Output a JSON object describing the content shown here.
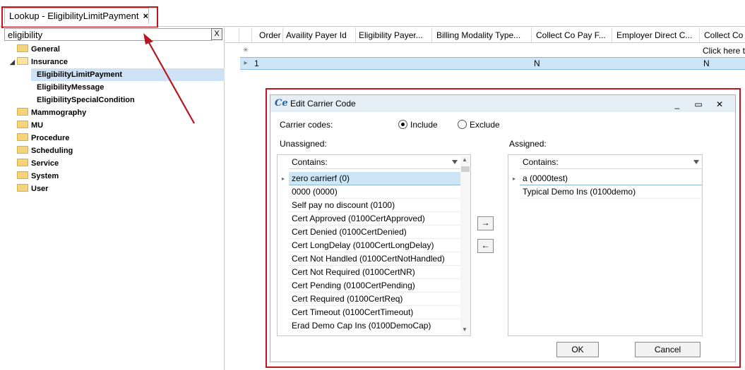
{
  "tab": {
    "title": "Lookup - EligibilityLimitPayment",
    "close": "×"
  },
  "tree": {
    "search_value": "eligibility",
    "clear_label": "X",
    "items": [
      {
        "label": "General"
      },
      {
        "label": "Insurance",
        "expanded": true
      },
      {
        "label": "EligibilityLimitPayment",
        "selected": true
      },
      {
        "label": "EligibilityMessage"
      },
      {
        "label": "EligibilitySpecialCondition"
      },
      {
        "label": "Mammography"
      },
      {
        "label": "MU"
      },
      {
        "label": "Procedure"
      },
      {
        "label": "Scheduling"
      },
      {
        "label": "Service"
      },
      {
        "label": "System"
      },
      {
        "label": "User"
      }
    ]
  },
  "grid": {
    "columns": [
      "Order",
      "Availity Payer Id",
      "Eligibility Payer...",
      "Billing Modality Type...",
      "Collect Co Pay F...",
      "Employer Direct C...",
      "Collect Co"
    ],
    "new_row_marker": "✳",
    "new_row_hint": "Click here t",
    "row_marker": "▸",
    "rows": [
      {
        "order": "1",
        "collect_co_pay": "N",
        "collect_co": "N"
      }
    ]
  },
  "dialog": {
    "logo": "Ce",
    "title": "Edit Carrier Code",
    "minimize": "_",
    "maximize": "▭",
    "close": "✕",
    "carrier_codes_label": "Carrier codes:",
    "include_label": "Include",
    "exclude_label": "Exclude",
    "include_selected": true,
    "unassigned_label": "Unassigned:",
    "assigned_label": "Assigned:",
    "filter_placeholder": "Contains:",
    "unassigned": [
      "zero carrierf (0)",
      "0000 (0000)",
      "Self pay no discount (0100)",
      "Cert Approved (0100CertApproved)",
      "Cert Denied (0100CertDenied)",
      "Cert LongDelay (0100CertLongDelay)",
      "Cert Not Handled (0100CertNotHandled)",
      "Cert Not Required (0100CertNR)",
      "Cert Pending (0100CertPending)",
      "Cert Required (0100CertReq)",
      "Cert Timeout (0100CertTimeout)",
      "Erad Demo Cap Ins (0100DemoCap)"
    ],
    "assigned": [
      "a (0000test)",
      "Typical Demo Ins (0100demo)"
    ],
    "move_right": "→",
    "move_left": "←",
    "ok_label": "OK",
    "cancel_label": "Cancel",
    "colors": {
      "selection": "#cde6f7",
      "highlight_border": "#c0141e",
      "title_bar": "#e5edf5"
    }
  }
}
